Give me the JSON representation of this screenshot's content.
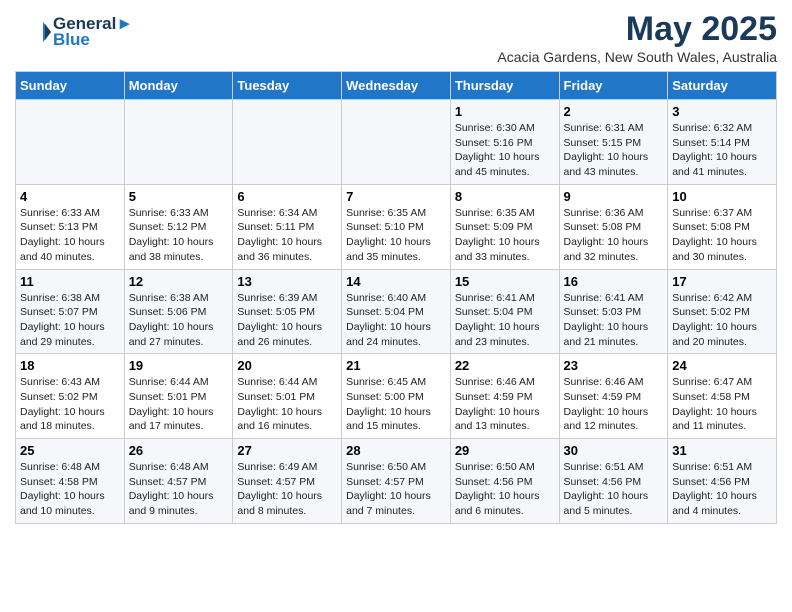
{
  "header": {
    "logo_line1": "General",
    "logo_line2": "Blue",
    "title": "May 2025",
    "subtitle": "Acacia Gardens, New South Wales, Australia"
  },
  "days_of_week": [
    "Sunday",
    "Monday",
    "Tuesday",
    "Wednesday",
    "Thursday",
    "Friday",
    "Saturday"
  ],
  "weeks": [
    {
      "row_shade": "odd",
      "days": [
        {
          "num": "",
          "info": ""
        },
        {
          "num": "",
          "info": ""
        },
        {
          "num": "",
          "info": ""
        },
        {
          "num": "",
          "info": ""
        },
        {
          "num": "1",
          "info": "Sunrise: 6:30 AM\nSunset: 5:16 PM\nDaylight: 10 hours\nand 45 minutes."
        },
        {
          "num": "2",
          "info": "Sunrise: 6:31 AM\nSunset: 5:15 PM\nDaylight: 10 hours\nand 43 minutes."
        },
        {
          "num": "3",
          "info": "Sunrise: 6:32 AM\nSunset: 5:14 PM\nDaylight: 10 hours\nand 41 minutes."
        }
      ]
    },
    {
      "row_shade": "even",
      "days": [
        {
          "num": "4",
          "info": "Sunrise: 6:33 AM\nSunset: 5:13 PM\nDaylight: 10 hours\nand 40 minutes."
        },
        {
          "num": "5",
          "info": "Sunrise: 6:33 AM\nSunset: 5:12 PM\nDaylight: 10 hours\nand 38 minutes."
        },
        {
          "num": "6",
          "info": "Sunrise: 6:34 AM\nSunset: 5:11 PM\nDaylight: 10 hours\nand 36 minutes."
        },
        {
          "num": "7",
          "info": "Sunrise: 6:35 AM\nSunset: 5:10 PM\nDaylight: 10 hours\nand 35 minutes."
        },
        {
          "num": "8",
          "info": "Sunrise: 6:35 AM\nSunset: 5:09 PM\nDaylight: 10 hours\nand 33 minutes."
        },
        {
          "num": "9",
          "info": "Sunrise: 6:36 AM\nSunset: 5:08 PM\nDaylight: 10 hours\nand 32 minutes."
        },
        {
          "num": "10",
          "info": "Sunrise: 6:37 AM\nSunset: 5:08 PM\nDaylight: 10 hours\nand 30 minutes."
        }
      ]
    },
    {
      "row_shade": "odd",
      "days": [
        {
          "num": "11",
          "info": "Sunrise: 6:38 AM\nSunset: 5:07 PM\nDaylight: 10 hours\nand 29 minutes."
        },
        {
          "num": "12",
          "info": "Sunrise: 6:38 AM\nSunset: 5:06 PM\nDaylight: 10 hours\nand 27 minutes."
        },
        {
          "num": "13",
          "info": "Sunrise: 6:39 AM\nSunset: 5:05 PM\nDaylight: 10 hours\nand 26 minutes."
        },
        {
          "num": "14",
          "info": "Sunrise: 6:40 AM\nSunset: 5:04 PM\nDaylight: 10 hours\nand 24 minutes."
        },
        {
          "num": "15",
          "info": "Sunrise: 6:41 AM\nSunset: 5:04 PM\nDaylight: 10 hours\nand 23 minutes."
        },
        {
          "num": "16",
          "info": "Sunrise: 6:41 AM\nSunset: 5:03 PM\nDaylight: 10 hours\nand 21 minutes."
        },
        {
          "num": "17",
          "info": "Sunrise: 6:42 AM\nSunset: 5:02 PM\nDaylight: 10 hours\nand 20 minutes."
        }
      ]
    },
    {
      "row_shade": "even",
      "days": [
        {
          "num": "18",
          "info": "Sunrise: 6:43 AM\nSunset: 5:02 PM\nDaylight: 10 hours\nand 18 minutes."
        },
        {
          "num": "19",
          "info": "Sunrise: 6:44 AM\nSunset: 5:01 PM\nDaylight: 10 hours\nand 17 minutes."
        },
        {
          "num": "20",
          "info": "Sunrise: 6:44 AM\nSunset: 5:01 PM\nDaylight: 10 hours\nand 16 minutes."
        },
        {
          "num": "21",
          "info": "Sunrise: 6:45 AM\nSunset: 5:00 PM\nDaylight: 10 hours\nand 15 minutes."
        },
        {
          "num": "22",
          "info": "Sunrise: 6:46 AM\nSunset: 4:59 PM\nDaylight: 10 hours\nand 13 minutes."
        },
        {
          "num": "23",
          "info": "Sunrise: 6:46 AM\nSunset: 4:59 PM\nDaylight: 10 hours\nand 12 minutes."
        },
        {
          "num": "24",
          "info": "Sunrise: 6:47 AM\nSunset: 4:58 PM\nDaylight: 10 hours\nand 11 minutes."
        }
      ]
    },
    {
      "row_shade": "odd",
      "days": [
        {
          "num": "25",
          "info": "Sunrise: 6:48 AM\nSunset: 4:58 PM\nDaylight: 10 hours\nand 10 minutes."
        },
        {
          "num": "26",
          "info": "Sunrise: 6:48 AM\nSunset: 4:57 PM\nDaylight: 10 hours\nand 9 minutes."
        },
        {
          "num": "27",
          "info": "Sunrise: 6:49 AM\nSunset: 4:57 PM\nDaylight: 10 hours\nand 8 minutes."
        },
        {
          "num": "28",
          "info": "Sunrise: 6:50 AM\nSunset: 4:57 PM\nDaylight: 10 hours\nand 7 minutes."
        },
        {
          "num": "29",
          "info": "Sunrise: 6:50 AM\nSunset: 4:56 PM\nDaylight: 10 hours\nand 6 minutes."
        },
        {
          "num": "30",
          "info": "Sunrise: 6:51 AM\nSunset: 4:56 PM\nDaylight: 10 hours\nand 5 minutes."
        },
        {
          "num": "31",
          "info": "Sunrise: 6:51 AM\nSunset: 4:56 PM\nDaylight: 10 hours\nand 4 minutes."
        }
      ]
    }
  ]
}
